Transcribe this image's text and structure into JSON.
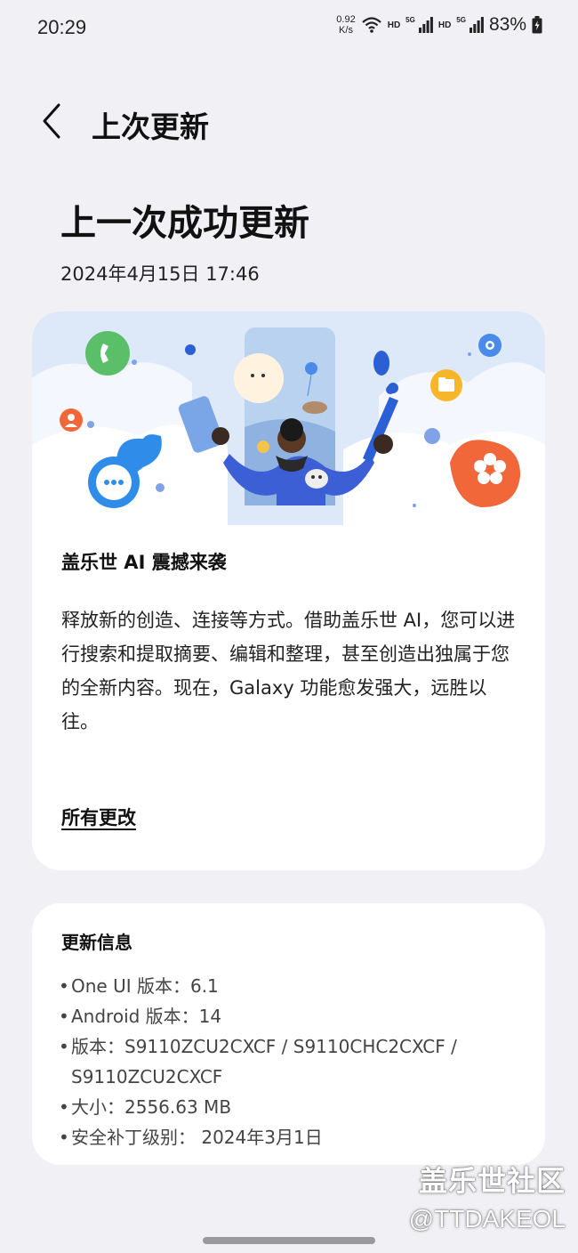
{
  "status_bar": {
    "time": "20:29",
    "net_speed_value": "0.92",
    "net_speed_unit": "K/s",
    "hd1": "HD",
    "net1": "5G",
    "hd2": "HD",
    "net2": "5G",
    "battery": "83%"
  },
  "header": {
    "back_icon": "chevron-left-icon",
    "title": "上次更新"
  },
  "page": {
    "title": "上一次成功更新",
    "date": "2024年4月15日 17:46"
  },
  "feature_card": {
    "heading": "盖乐世 AI 震撼来袭",
    "body": "释放新的创造、连接等方式。借助盖乐世 AI，您可以进行搜索和提取摘要、编辑和整理，甚至创造出独属于您的全新内容。现在，Galaxy 功能愈发强大，远胜以往。",
    "link": "所有更改"
  },
  "info_card": {
    "heading": "更新信息",
    "items": [
      "One UI 版本：6.1",
      "Android 版本：14",
      "版本：S9110ZCU2CXCF / S9110CHC2CXCF / S9110ZCU2CXCF",
      "大小：2556.63 MB",
      "安全补丁级别： 2024年3月1日"
    ]
  },
  "watermark": {
    "line1": "盖乐世社区",
    "line2": "@TTDAKEOL"
  },
  "colors": {
    "background": "#f1f1f5",
    "card": "#ffffff",
    "illustration_sky": "#dde8f8",
    "phone_icon_green": "#5bbf6a",
    "chat_icon_blue": "#2f8ce8",
    "flower_orange": "#f2673a",
    "folder_yellow": "#f6b629",
    "person_blue": "#3d5fd6"
  }
}
